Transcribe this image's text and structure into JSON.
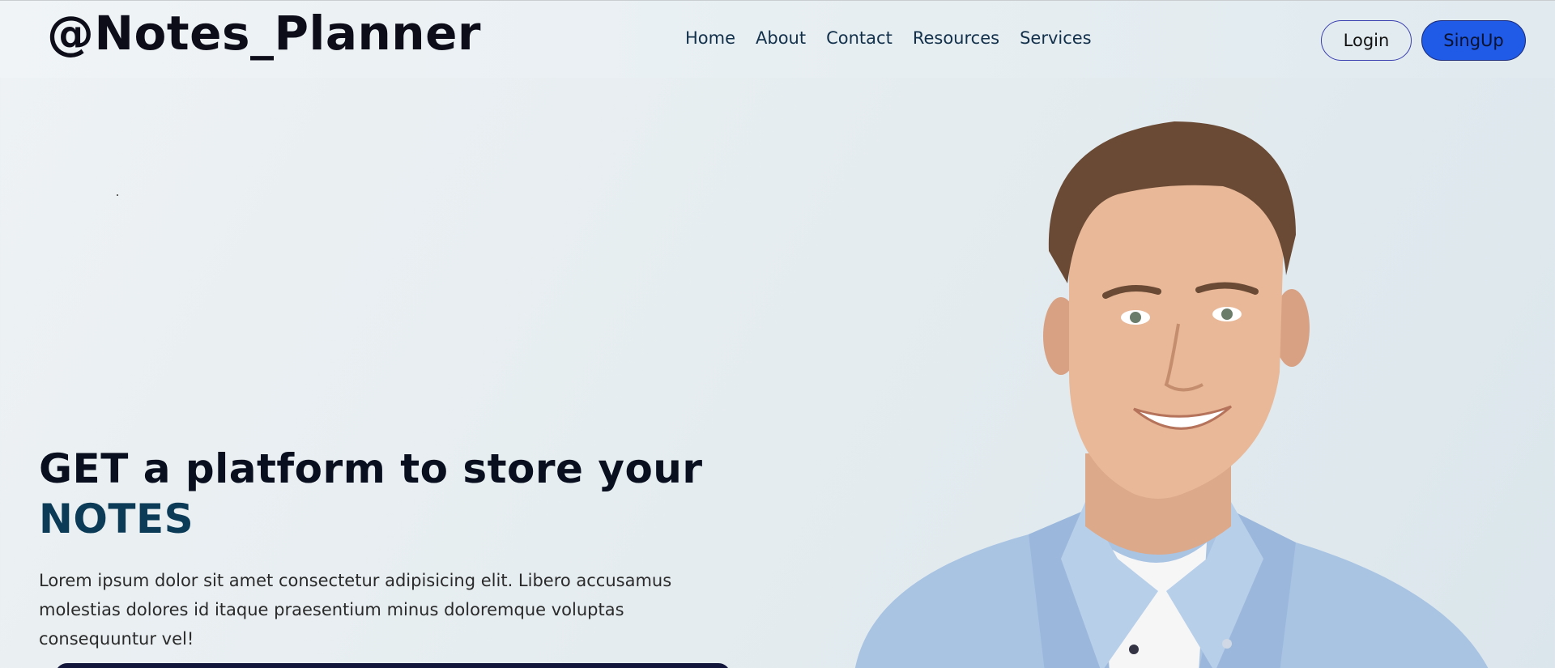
{
  "brand": "@Notes_Planner",
  "nav": {
    "links": [
      "Home",
      "About",
      "Contact",
      "Resources",
      "Services"
    ]
  },
  "auth": {
    "login_label": "Login",
    "signup_label": "SingUp"
  },
  "hero": {
    "title_line1": "GET a platform to store your",
    "title_accent": "NOTES",
    "description": "Lorem ipsum dolor sit amet consectetur adipisicing elit. Libero accusamus molestias dolores id itaque praesentium minus doloremque voluptas consequuntur vel!"
  },
  "colors": {
    "accent_blue": "#1f5be6",
    "notes_accent": "#0b3b57",
    "cta_dark": "#12163a"
  }
}
